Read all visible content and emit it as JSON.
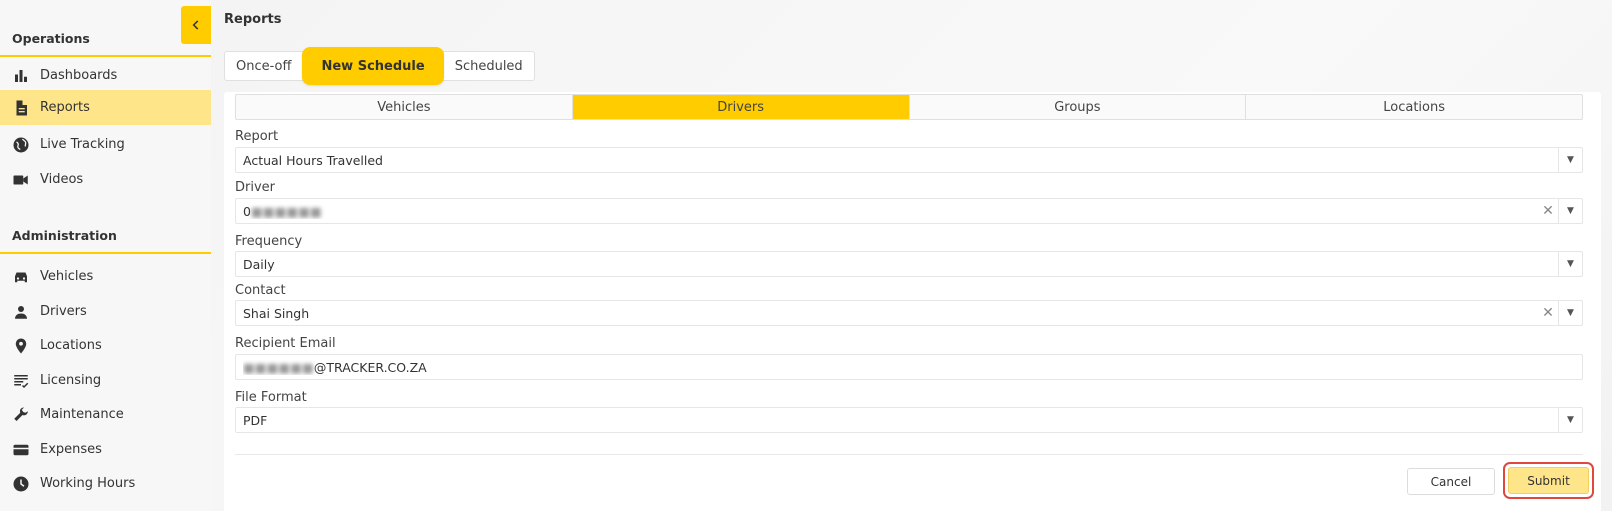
{
  "sidebar": {
    "operations_title": "Operations",
    "operations_items": [
      {
        "label": "Dashboards",
        "icon": "bar-chart-icon"
      },
      {
        "label": "Reports",
        "icon": "document-icon",
        "active": true
      },
      {
        "label": "Live Tracking",
        "icon": "globe-icon"
      },
      {
        "label": "Videos",
        "icon": "video-camera-icon"
      }
    ],
    "administration_title": "Administration",
    "administration_items": [
      {
        "label": "Vehicles",
        "icon": "car-icon"
      },
      {
        "label": "Drivers",
        "icon": "person-icon"
      },
      {
        "label": "Locations",
        "icon": "map-pin-icon"
      },
      {
        "label": "Licensing",
        "icon": "list-check-icon"
      },
      {
        "label": "Maintenance",
        "icon": "wrench-icon"
      },
      {
        "label": "Expenses",
        "icon": "card-icon"
      },
      {
        "label": "Working Hours",
        "icon": "clock-icon"
      }
    ]
  },
  "header": {
    "title": "Reports"
  },
  "top_tabs": [
    {
      "label": "Once-off"
    },
    {
      "label": "New Schedule",
      "active": true
    },
    {
      "label": "Scheduled"
    }
  ],
  "sub_tabs": [
    {
      "label": "Vehicles"
    },
    {
      "label": "Drivers",
      "active": true
    },
    {
      "label": "Groups"
    },
    {
      "label": "Locations"
    }
  ],
  "form": {
    "report": {
      "label": "Report",
      "value": "Actual Hours Travelled"
    },
    "driver": {
      "label": "Driver",
      "value_prefix": "0",
      "value_masked": "■■■■■■"
    },
    "frequency": {
      "label": "Frequency",
      "value": "Daily"
    },
    "contact": {
      "label": "Contact",
      "value": "Shai Singh"
    },
    "recipient_email": {
      "label": "Recipient Email",
      "value_masked": "■■■■■■",
      "value_suffix": "@TRACKER.CO.ZA"
    },
    "file_format": {
      "label": "File Format",
      "value": "PDF"
    }
  },
  "actions": {
    "cancel_label": "Cancel",
    "submit_label": "Submit"
  },
  "colors": {
    "accent": "#ffcc00",
    "active_nav": "#ffe58a",
    "highlight_ring": "#e0473f"
  }
}
